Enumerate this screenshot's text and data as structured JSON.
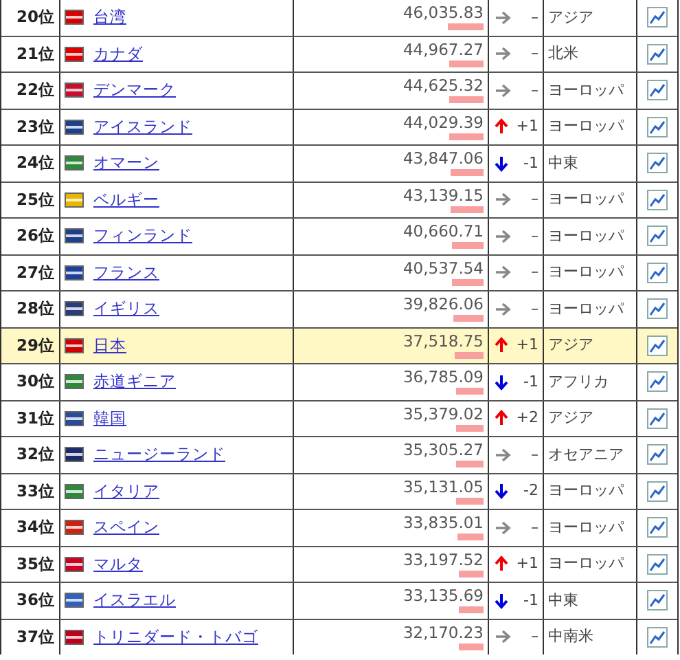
{
  "rows": [
    {
      "rank": "20位",
      "country": "台湾",
      "color": "#d80000",
      "value": "46,035.83",
      "level": 0.186,
      "kind": "flat",
      "change": "–",
      "region": "アジア",
      "highlighted": false
    },
    {
      "rank": "21位",
      "country": "カナダ",
      "color": "#e00000",
      "value": "44,967.27",
      "level": 0.181,
      "kind": "flat",
      "change": "–",
      "region": "北米",
      "highlighted": false
    },
    {
      "rank": "22位",
      "country": "デンマーク",
      "color": "#c8102e",
      "value": "44,625.32",
      "level": 0.18,
      "kind": "flat",
      "change": "–",
      "region": "ヨーロッパ",
      "highlighted": false
    },
    {
      "rank": "23位",
      "country": "アイスランド",
      "color": "#1e3f8c",
      "value": "44,029.39",
      "level": 0.178,
      "kind": "up",
      "change": "+1",
      "region": "ヨーロッパ",
      "highlighted": false
    },
    {
      "rank": "24位",
      "country": "オマーン",
      "color": "#2d8a3a",
      "value": "43,847.06",
      "level": 0.177,
      "kind": "down",
      "change": "-1",
      "region": "中東",
      "highlighted": false
    },
    {
      "rank": "25位",
      "country": "ベルギー",
      "color": "#e8b800",
      "value": "43,139.15",
      "level": 0.174,
      "kind": "flat",
      "change": "–",
      "region": "ヨーロッパ",
      "highlighted": false
    },
    {
      "rank": "26位",
      "country": "フィンランド",
      "color": "#1e3f8c",
      "value": "40,660.71",
      "level": 0.164,
      "kind": "flat",
      "change": "–",
      "region": "ヨーロッパ",
      "highlighted": false
    },
    {
      "rank": "27位",
      "country": "フランス",
      "color": "#1e3fa0",
      "value": "40,537.54",
      "level": 0.164,
      "kind": "flat",
      "change": "–",
      "region": "ヨーロッパ",
      "highlighted": false
    },
    {
      "rank": "28位",
      "country": "イギリス",
      "color": "#2a3c7a",
      "value": "39,826.06",
      "level": 0.161,
      "kind": "flat",
      "change": "–",
      "region": "ヨーロッパ",
      "highlighted": false
    },
    {
      "rank": "29位",
      "country": "日本",
      "color": "#d00000",
      "value": "37,518.75",
      "level": 0.151,
      "kind": "up",
      "change": "+1",
      "region": "アジア",
      "highlighted": true
    },
    {
      "rank": "30位",
      "country": "赤道ギニア",
      "color": "#2d8a3a",
      "value": "36,785.09",
      "level": 0.148,
      "kind": "down",
      "change": "-1",
      "region": "アフリカ",
      "highlighted": false
    },
    {
      "rank": "31位",
      "country": "韓国",
      "color": "#2a4a9a",
      "value": "35,379.02",
      "level": 0.143,
      "kind": "up",
      "change": "+2",
      "region": "アジア",
      "highlighted": false
    },
    {
      "rank": "32位",
      "country": "ニュージーランド",
      "color": "#1a2a6a",
      "value": "35,305.27",
      "level": 0.142,
      "kind": "flat",
      "change": "–",
      "region": "オセアニア",
      "highlighted": false
    },
    {
      "rank": "33位",
      "country": "イタリア",
      "color": "#2d8a3a",
      "value": "35,131.05",
      "level": 0.142,
      "kind": "down",
      "change": "-2",
      "region": "ヨーロッパ",
      "highlighted": false
    },
    {
      "rank": "34位",
      "country": "スペイン",
      "color": "#d02010",
      "value": "33,835.01",
      "level": 0.137,
      "kind": "flat",
      "change": "–",
      "region": "ヨーロッパ",
      "highlighted": false
    },
    {
      "rank": "35位",
      "country": "マルタ",
      "color": "#d00020",
      "value": "33,197.52",
      "level": 0.134,
      "kind": "up",
      "change": "+1",
      "region": "ヨーロッパ",
      "highlighted": false
    },
    {
      "rank": "36位",
      "country": "イスラエル",
      "color": "#3060c0",
      "value": "33,135.69",
      "level": 0.134,
      "kind": "down",
      "change": "-1",
      "region": "中東",
      "highlighted": false
    },
    {
      "rank": "37位",
      "country": "トリニダード・トバゴ",
      "color": "#c00018",
      "value": "32,170.23",
      "level": 0.13,
      "kind": "flat",
      "change": "–",
      "region": "中南米",
      "highlighted": false
    }
  ]
}
